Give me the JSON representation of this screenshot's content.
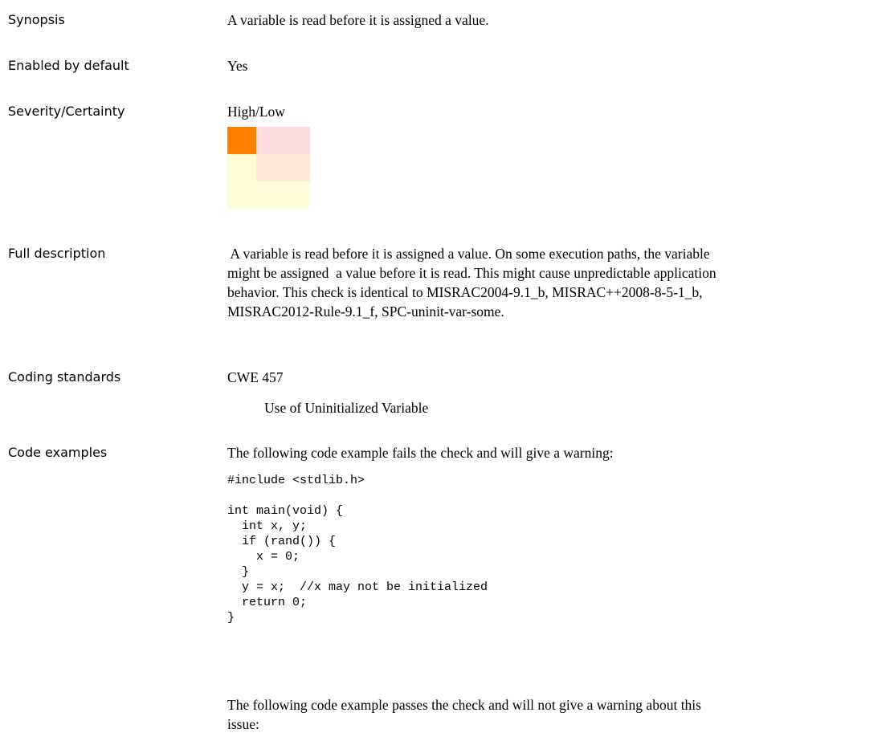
{
  "labels": {
    "synopsis": "Synopsis",
    "enabled": "Enabled by default",
    "severity": "Severity/Certainty",
    "full_description": "Full description",
    "coding_standards": "Coding standards",
    "code_examples": "Code examples"
  },
  "synopsis": "A variable is read before it is assigned a value.",
  "enabled_by_default": "Yes",
  "severity_certainty": "High/Low",
  "severity_matrix": {
    "highlighted_cell": "High/Low",
    "colors": {
      "highlight": "#ff7f00",
      "row1": "#fddcdc",
      "row2_mid": "#fde8d8",
      "light": "#fffdd6"
    }
  },
  "full_description_lines": [
    " A variable is read before it is assigned a value. On some execution paths, the variable",
    "might be assigned  a value before it is read. This might cause unpredictable application",
    "behavior. This check is identical to MISRAC2004-9.1_b, MISRAC++2008-8-5-1_b,",
    "MISRAC2012-Rule-9.1_f, SPC-uninit-var-some."
  ],
  "coding_standard": {
    "id": "CWE 457",
    "title": "Use of Uninitialized Variable"
  },
  "code_examples": {
    "fail_intro": "The following code example fails the check and will give a warning:",
    "fail_code": "#include <stdlib.h>\n\nint main(void) {\n  int x, y;\n  if (rand()) {\n    x = 0;\n  }\n  y = x;  //x may not be initialized\n  return 0;\n}",
    "pass_intro_lines": [
      "The following code example passes the check and will not give a warning about this",
      "issue:"
    ]
  }
}
